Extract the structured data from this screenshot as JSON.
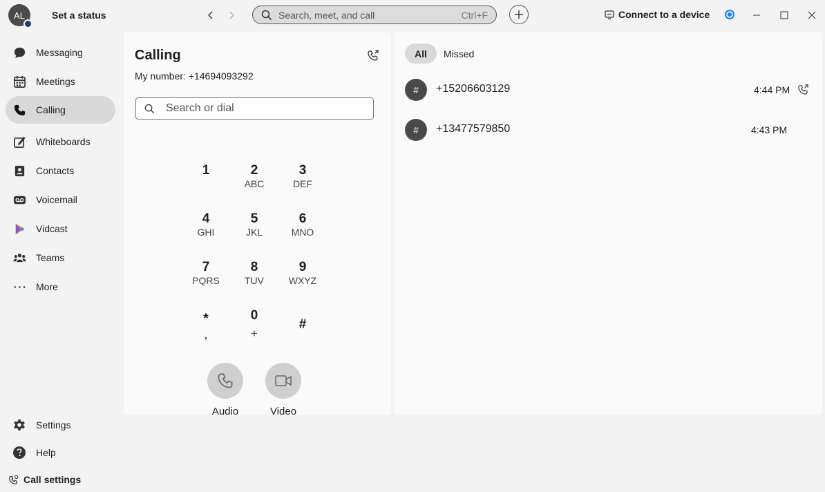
{
  "titlebar": {
    "avatar_initials": "AL",
    "status_label": "Set a status",
    "search_placeholder": "Search, meet, and call",
    "search_shortcut": "Ctrl+F",
    "connect_label": "Connect to a device"
  },
  "sidebar": {
    "items": [
      {
        "label": "Messaging",
        "icon": "chat-bubble-icon"
      },
      {
        "label": "Meetings",
        "icon": "calendar-icon"
      },
      {
        "label": "Calling",
        "icon": "phone-icon",
        "active": true
      },
      {
        "label": "Whiteboards",
        "icon": "whiteboard-icon"
      },
      {
        "label": "Contacts",
        "icon": "contacts-icon"
      },
      {
        "label": "Voicemail",
        "icon": "voicemail-icon"
      },
      {
        "label": "Vidcast",
        "icon": "vidcast-icon"
      },
      {
        "label": "Teams",
        "icon": "teams-icon"
      },
      {
        "label": "More",
        "icon": "more-icon"
      }
    ],
    "footer": {
      "settings_label": "Settings",
      "help_label": "Help",
      "call_settings_label": "Call settings"
    }
  },
  "calling": {
    "title": "Calling",
    "my_number": "My number: +14694093292",
    "dial_placeholder": "Search or dial",
    "keypad": [
      {
        "digit": "1",
        "letters": ""
      },
      {
        "digit": "2",
        "letters": "ABC"
      },
      {
        "digit": "3",
        "letters": "DEF"
      },
      {
        "digit": "4",
        "letters": "GHI"
      },
      {
        "digit": "5",
        "letters": "JKL"
      },
      {
        "digit": "6",
        "letters": "MNO"
      },
      {
        "digit": "7",
        "letters": "PQRS"
      },
      {
        "digit": "8",
        "letters": "TUV"
      },
      {
        "digit": "9",
        "letters": "WXYZ"
      },
      {
        "digit": "*",
        "letters": ","
      },
      {
        "digit": "0",
        "letters": "+"
      },
      {
        "digit": "#",
        "letters": ""
      }
    ],
    "audio_label": "Audio",
    "video_label": "Video"
  },
  "history": {
    "tabs": [
      {
        "label": "All",
        "active": true
      },
      {
        "label": "Missed",
        "active": false
      }
    ],
    "rows": [
      {
        "avatar": "#",
        "number": "+15206603129",
        "time": "4:44 PM"
      },
      {
        "avatar": "#",
        "number": "+13477579850",
        "time": "4:43 PM"
      }
    ]
  },
  "colors": {
    "background": "#f3f3f3",
    "panel": "#fafafa",
    "active_nav": "#d9d9d9",
    "avatar": "#4a4a4a",
    "presence": "#1b3f73",
    "sync_accent": "#1e88e5"
  }
}
